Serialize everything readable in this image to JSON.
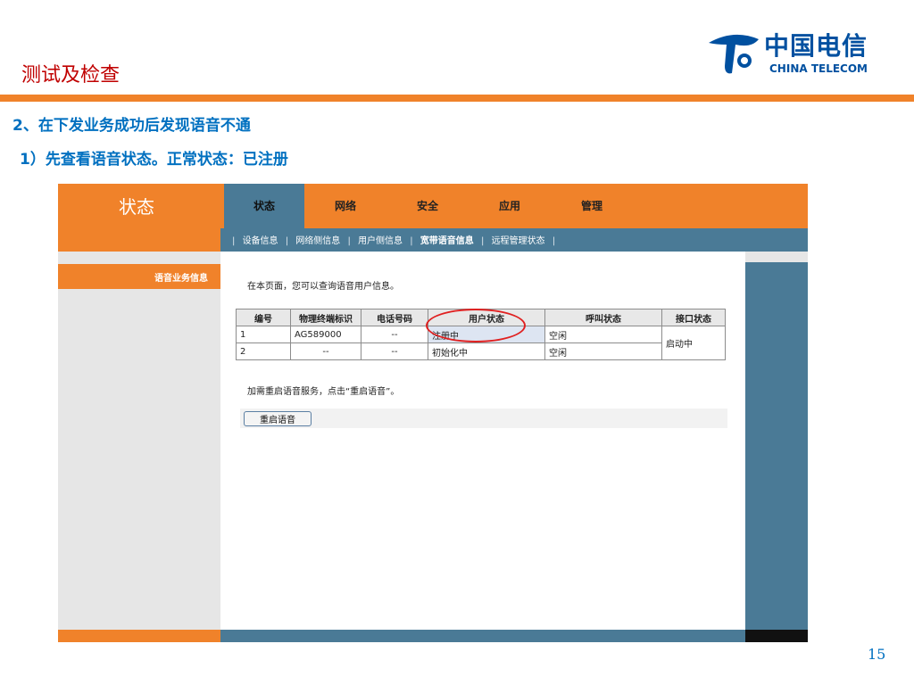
{
  "slide": {
    "title": "测试及检查",
    "line1": "2、在下发业务成功后发现语音不通",
    "line2": "1）先查看语音状态。正常状态：已注册",
    "page_number": "15",
    "logo_cn": "中国电信",
    "logo_en": "CHINA TELECOM",
    "accent_color": "#f0822a",
    "title_color": "#c00000",
    "text_color": "#0070c0"
  },
  "router_ui": {
    "section_title": "状态",
    "nav_tabs": [
      "状态",
      "网络",
      "安全",
      "应用",
      "管理"
    ],
    "active_tab": "状态",
    "subnav": [
      "设备信息",
      "网络侧信息",
      "用户侧信息",
      "宽带语音信息",
      "远程管理状态"
    ],
    "active_subnav": "宽带语音信息",
    "sidebar_item": "语音业务信息",
    "intro": "在本页面，您可以查询语音用户信息。",
    "table": {
      "headers": [
        "编号",
        "物理终端标识",
        "电话号码",
        "用户状态",
        "呼叫状态",
        "接口状态"
      ],
      "rows": [
        [
          "1",
          "AG589000",
          "--",
          "注册中",
          "空闲"
        ],
        [
          "2",
          "--",
          "--",
          "初始化中",
          "空闲"
        ]
      ],
      "interface_status": "启动中"
    },
    "restart_hint": "加需重启语音服务，点击“重启语音”。",
    "restart_button": "重启语音",
    "primary_color": "#4a7a96"
  }
}
